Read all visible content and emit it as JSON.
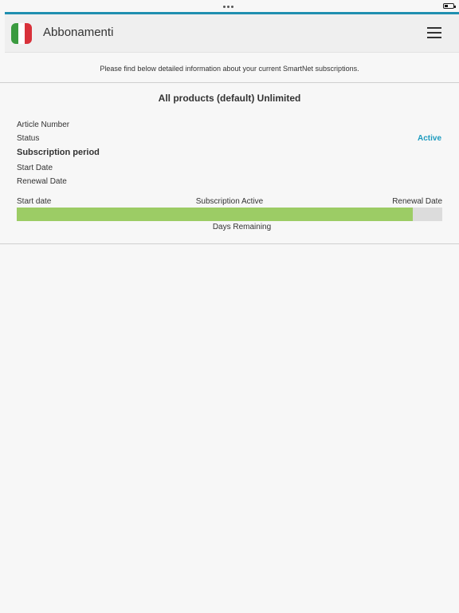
{
  "app": {
    "title": "Abbonamenti",
    "flag_colors": [
      "#3a9a3f",
      "#ffffff",
      "#d8313a"
    ]
  },
  "intro_text": "Please find below detailed information about your current SmartNet subscriptions.",
  "subscription": {
    "product_title": "All products (default) Unlimited",
    "article_number_label": "Article Number",
    "status_label": "Status",
    "status_value": "Active",
    "period_heading": "Subscription period",
    "start_date_label": "Start Date",
    "renewal_date_label": "Renewal Date"
  },
  "progress": {
    "start_label": "Start date",
    "center_label": "Subscription Active",
    "end_label": "Renewal Date",
    "days_remaining_label": "Days Remaining",
    "fill_fraction": 0.93,
    "fill_color": "#9ccc65",
    "track_color": "#dcdcdc"
  },
  "colors": {
    "accent": "#1f8fb0",
    "status_active": "#1d9bbf"
  }
}
